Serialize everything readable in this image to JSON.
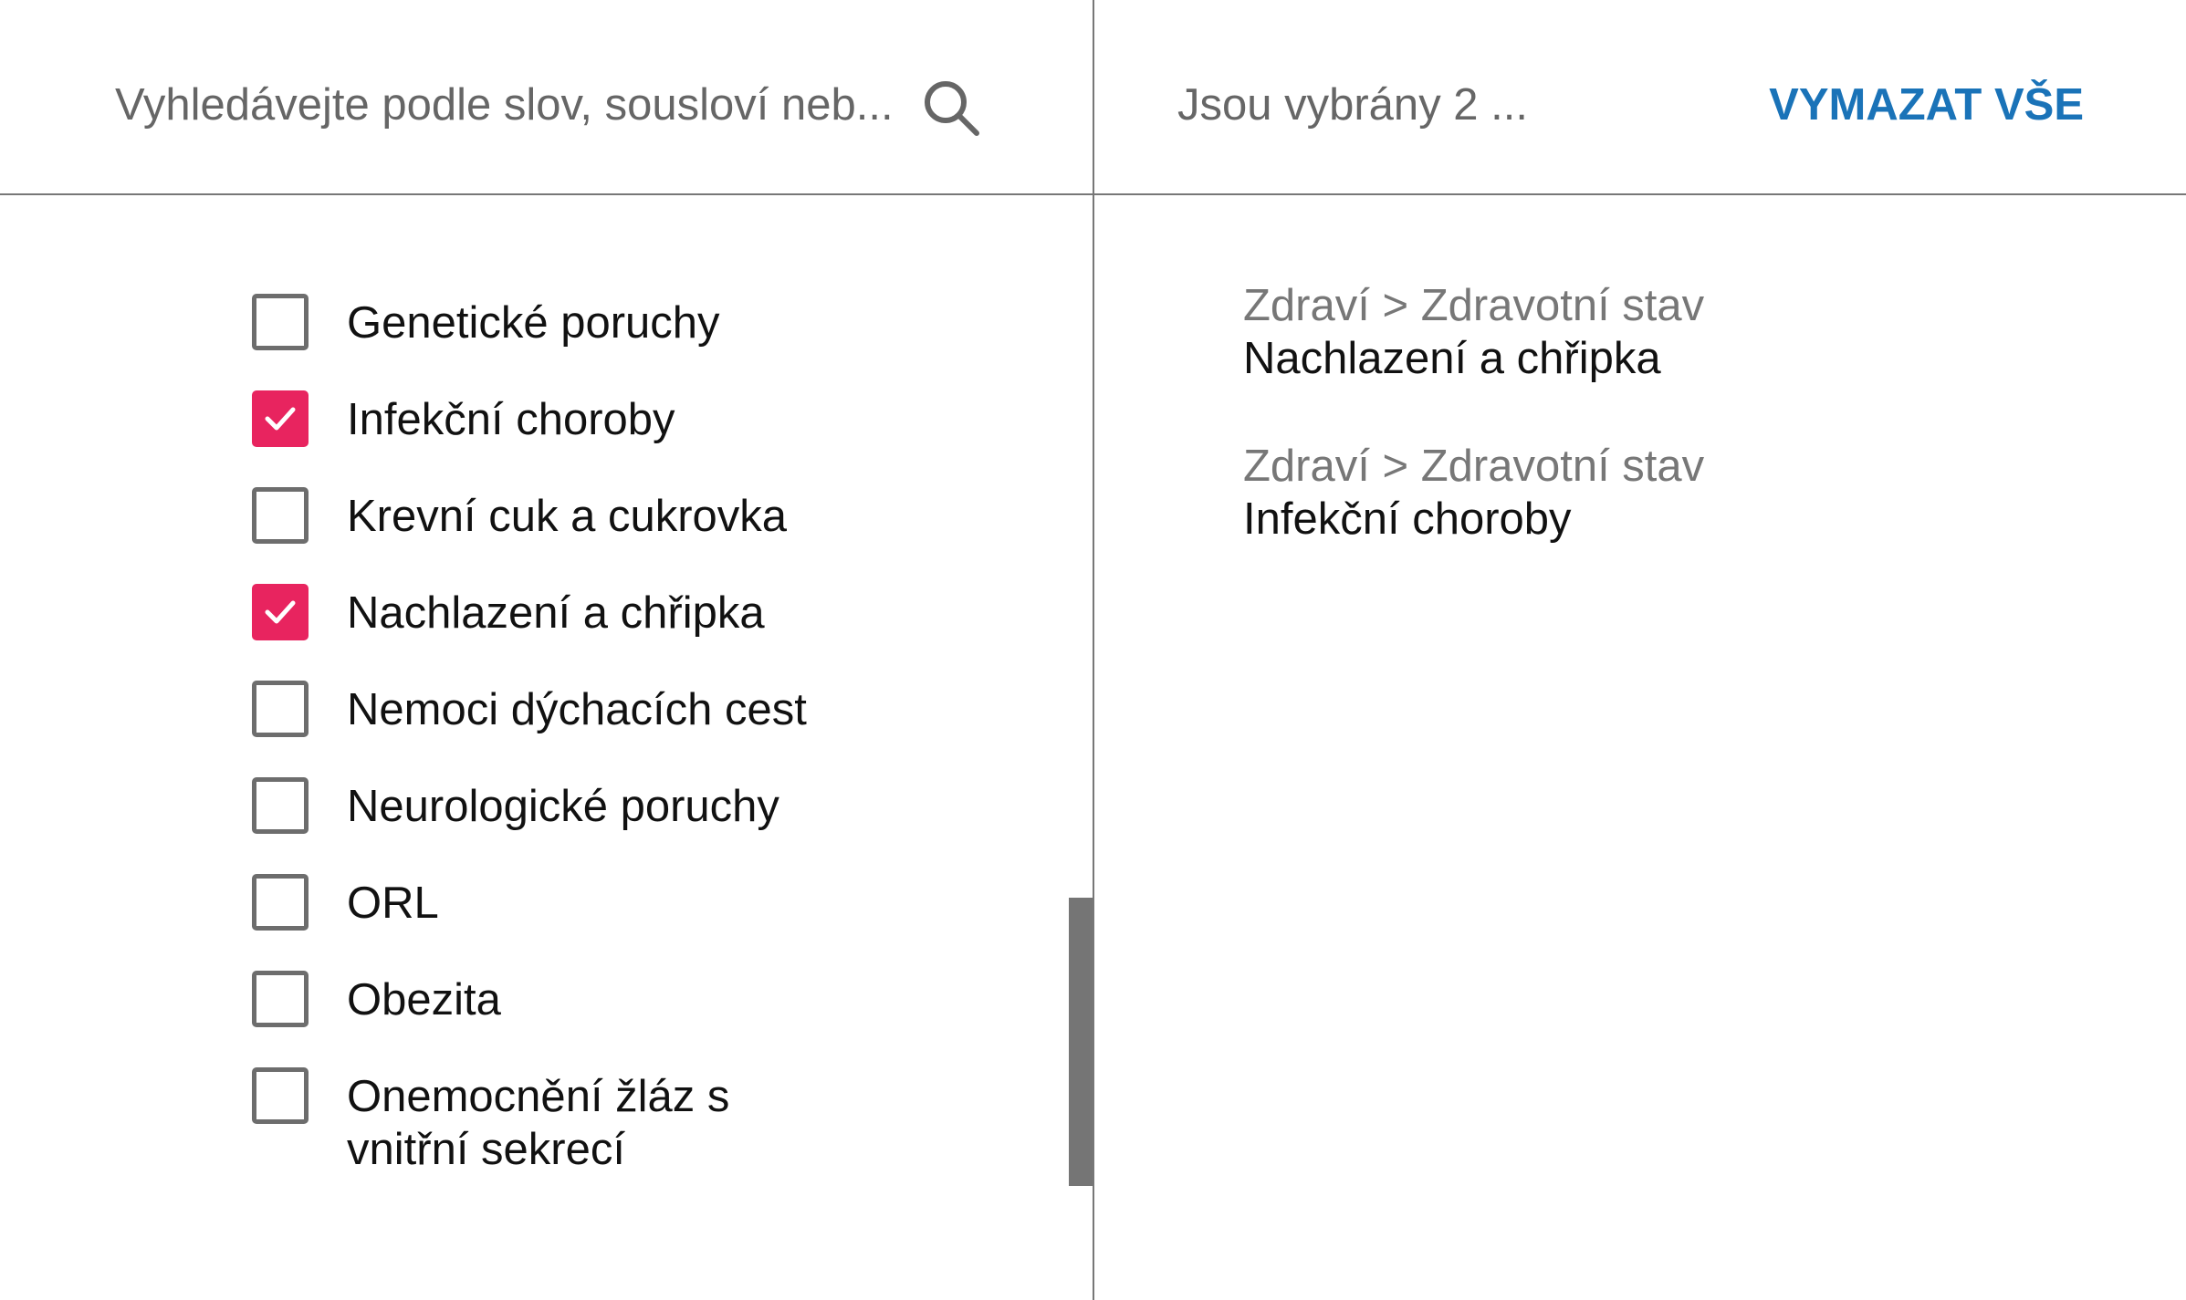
{
  "search": {
    "placeholder": "Vyhledávejte podle slov, sousloví neb..."
  },
  "summary": {
    "selected_text": "Jsou vybrány 2 ...",
    "clear_all_label": "VYMAZAT VŠE"
  },
  "options": [
    {
      "label": "Genetické poruchy",
      "checked": false
    },
    {
      "label": "Infekční choroby",
      "checked": true
    },
    {
      "label": "Krevní cuk a cukrovka",
      "checked": false
    },
    {
      "label": "Nachlazení a chřipka",
      "checked": true
    },
    {
      "label": "Nemoci dýchacích cest",
      "checked": false
    },
    {
      "label": "Neurologické poruchy",
      "checked": false
    },
    {
      "label": "ORL",
      "checked": false
    },
    {
      "label": "Obezita",
      "checked": false
    },
    {
      "label": "Onemocnění žláz s vnitřní sekrecí",
      "checked": false
    }
  ],
  "selected": [
    {
      "path": "Zdraví > Zdravotní stav",
      "label": "Nachlazení a chřipka"
    },
    {
      "path": "Zdraví > Zdravotní stav",
      "label": "Infekční choroby"
    }
  ],
  "colors": {
    "accent": "#1a73b8",
    "checkbox_checked": "#e8245f",
    "divider": "#777777"
  },
  "icons": {
    "search": "search-icon",
    "check": "checkmark-icon"
  }
}
